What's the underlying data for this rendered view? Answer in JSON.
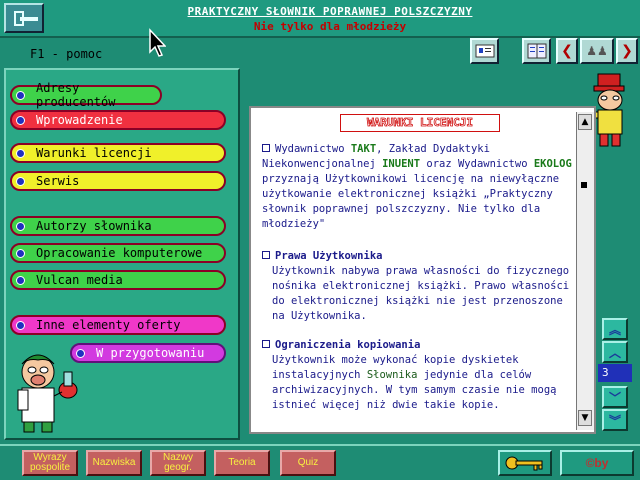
{
  "header": {
    "title": "PRAKTYCZNY SŁOWNIK POPRAWNEJ POLSZCZYZNY",
    "subtitle": "Nie tylko dla młodzieży"
  },
  "help": {
    "text": "F1 - pomoc"
  },
  "toolbar": {
    "buttons": [
      {
        "icon": "screen-icon"
      },
      {
        "icon": "book-icon"
      },
      {
        "icon": "arrow-left-icon",
        "glyph": "❮"
      },
      {
        "icon": "figures-icon",
        "glyph": "♟♟"
      },
      {
        "icon": "arrow-right-icon",
        "glyph": "❯"
      }
    ]
  },
  "menu": {
    "items": [
      {
        "label": "Adresy producentów"
      },
      {
        "label": "Wprowadzenie"
      },
      {
        "label": "Warunki licencji"
      },
      {
        "label": "Serwis"
      },
      {
        "label": "Autorzy słownika"
      },
      {
        "label": "Opracowanie komputerowe"
      },
      {
        "label": "Vulcan media"
      },
      {
        "label": "Inne elementy oferty"
      },
      {
        "label": "W przygotowaniu"
      }
    ]
  },
  "content": {
    "heading": "WARUNKI LICENCJI",
    "p1_a": "Wydawnictwo ",
    "p1_takt": "TAKT",
    "p1_b": ", Zakład Dydaktyki Niekonwencjonalnej ",
    "p1_inuent": "INUENT",
    "p1_c": " oraz Wydawnictwo ",
    "p1_ekolog": "EKOLOG",
    "p1_d": " przyznają Użytkownikowi licencję na niewyłączne użytkowanie elektronicznej książki „Praktyczny słownik poprawnej polszczyzny. Nie tylko dla młodzieży\"",
    "h2": "Prawa Użytkownika",
    "p2": "Użytkownik nabywa prawa własności do fizycznego nośnika elektronicznej książki. Prawo własności do elektronicznej książki nie jest przenoszone na Użytkownika.",
    "h3": "Ograniczenia kopiowania",
    "p3_a": "Użytkownik może wykonać kopie dyskietek instalacyjnych ",
    "p3_slownika": "Słownika",
    "p3_b": " jedynie dla celów archiwizacyjnych. W tym samym czasie nie mogą istnieć więcej niż dwie takie kopie."
  },
  "scroll": {
    "up": "▲",
    "down": "▼"
  },
  "side": {
    "page": "3"
  },
  "bottom": {
    "buttons": [
      {
        "label": "Wyrazy pospolite"
      },
      {
        "label": "Nazwiska"
      },
      {
        "label": "Nazwy geogr."
      },
      {
        "label": "Teoria"
      },
      {
        "label": "Quiz"
      }
    ],
    "copyright": "©by"
  }
}
